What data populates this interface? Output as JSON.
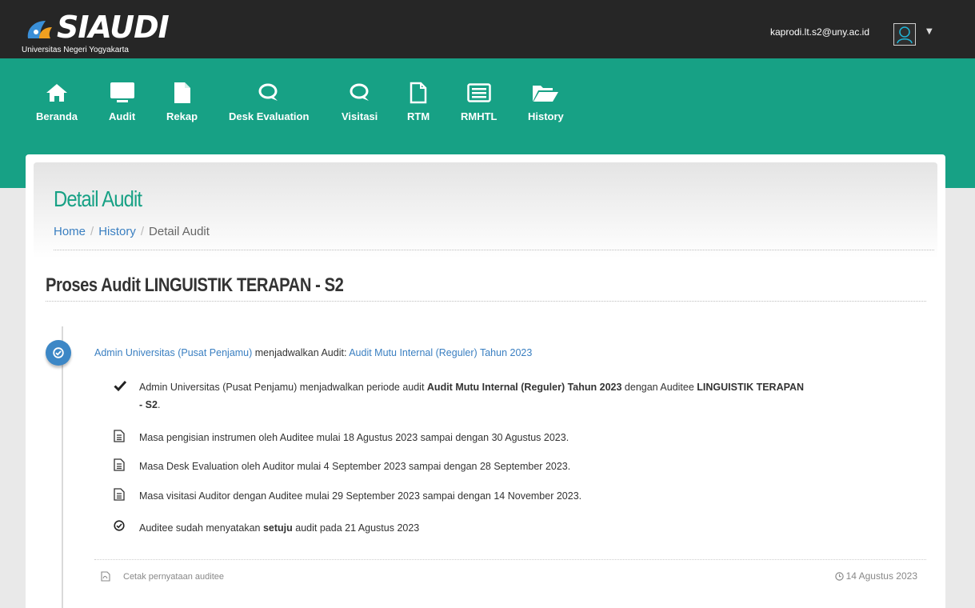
{
  "app": {
    "logo_text": "SIAUDI",
    "logo_subtitle": "Universitas Negeri Yogyakarta",
    "user_email": "kaprodi.lt.s2@uny.ac.id"
  },
  "nav": {
    "items": [
      {
        "label": "Beranda",
        "icon": "home-icon"
      },
      {
        "label": "Audit",
        "icon": "monitor-icon"
      },
      {
        "label": "Rekap",
        "icon": "file-icon"
      },
      {
        "label": "Desk Evaluation",
        "icon": "comment-icon"
      },
      {
        "label": "Visitasi",
        "icon": "comment-icon"
      },
      {
        "label": "RTM",
        "icon": "file-outline-icon"
      },
      {
        "label": "RMHTL",
        "icon": "list-alt-icon"
      },
      {
        "label": "History",
        "icon": "folder-open-icon"
      }
    ]
  },
  "page": {
    "title": "Detail Audit",
    "breadcrumb": {
      "home": "Home",
      "history": "History",
      "current": "Detail Audit"
    },
    "section_title": "Proses Audit LINGUISTIK TERAPAN - S2"
  },
  "timeline": {
    "head": {
      "actor": "Admin Universitas (Pusat Penjamu)",
      "verb": " menjadwalkan Audit: ",
      "audit_link": "Audit Mutu Internal (Reguler) Tahun 2023"
    },
    "rows": {
      "r1": {
        "pre": "Admin Universitas (Pusat Penjamu) menjadwalkan periode audit ",
        "bold1": "Audit Mutu Internal (Reguler) Tahun 2023",
        "mid": " dengan Auditee ",
        "bold2a": "LINGUISTIK TERAPAN",
        "bold2b": "- S2",
        "end": "."
      },
      "r2": "Masa pengisian instrumen oleh Auditee mulai 18 Agustus 2023 sampai dengan 30 Agustus 2023.",
      "r3": "Masa Desk Evaluation oleh Auditor mulai 4 September 2023 sampai dengan 28 September 2023.",
      "r4": "Masa visitasi Auditor dengan Auditee mulai 29 September 2023 sampai dengan 14 November 2023.",
      "r5": {
        "pre": "Auditee sudah menyatakan ",
        "bold": "setuju",
        "end": " audit pada 21 Agustus 2023"
      }
    },
    "footer": {
      "print_label": "Cetak pernyataan auditee",
      "date": "14 Agustus 2023"
    }
  },
  "colors": {
    "accent": "#17a185",
    "topbar": "#262626",
    "link": "#3a7fc1",
    "badge": "#3c87c6"
  }
}
